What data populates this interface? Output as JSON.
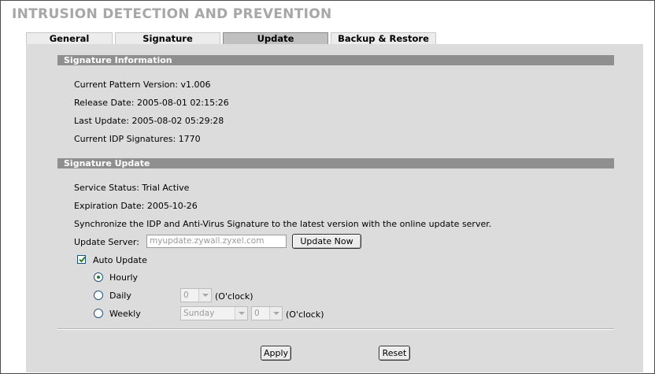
{
  "page_title": "INTRUSION DETECTION AND PREVENTION",
  "tabs": [
    {
      "label": "General"
    },
    {
      "label": "Signature"
    },
    {
      "label": "Update"
    },
    {
      "label": "Backup & Restore"
    }
  ],
  "signature_info": {
    "heading": "Signature Information",
    "current_pattern_version": "Current Pattern Version: v1.006",
    "release_date": "Release Date: 2005-08-01 02:15:26",
    "last_update": "Last Update: 2005-08-02 05:29:28",
    "current_idp_signatures": "Current IDP Signatures: 1770"
  },
  "signature_update": {
    "heading": "Signature Update",
    "service_status": "Service Status: Trial Active",
    "expiration_date": "Expiration Date: 2005-10-26",
    "sync_text": "Synchronize the IDP and Anti-Virus Signature to the latest version with the online update server.",
    "update_server_label": "Update Server:",
    "update_server_value": "myupdate.zywall.zyxel.com",
    "update_now_label": "Update Now",
    "auto_update_label": "Auto Update",
    "auto_update_checked": true,
    "hourly_label": "Hourly",
    "daily_label": "Daily",
    "weekly_label": "Weekly",
    "selected_frequency": "Hourly",
    "daily_hour": "0",
    "weekly_day": "Sunday",
    "weekly_hour": "0",
    "oclock_label": "(O'clock)"
  },
  "actions": {
    "apply_label": "Apply",
    "reset_label": "Reset"
  }
}
